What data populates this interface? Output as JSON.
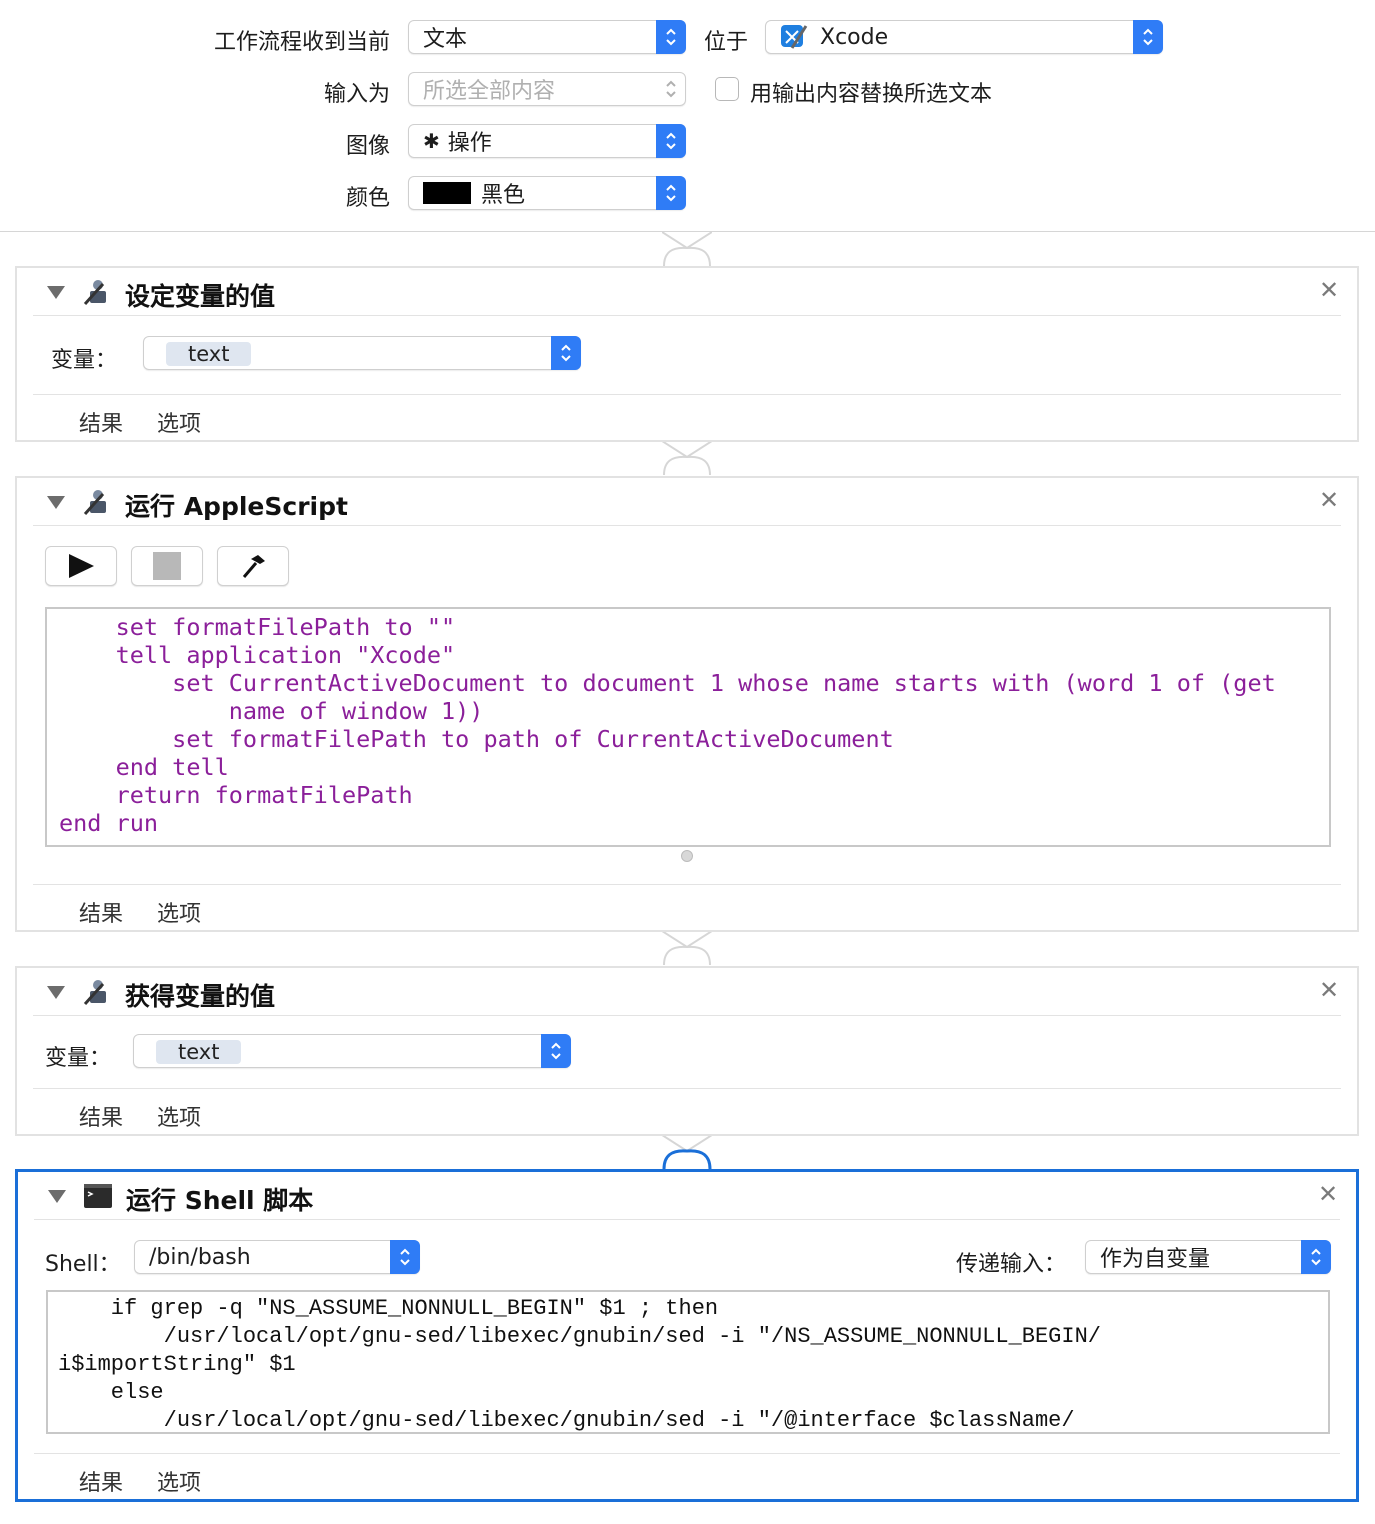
{
  "header": {
    "receives_label": "工作流程收到当前",
    "receives_value": "文本",
    "in_label": "位于",
    "in_value": "Xcode",
    "input_label": "输入为",
    "input_value": "所选全部内容",
    "replace_label": "用输出内容替换所选文本",
    "image_label": "图像",
    "image_value": "操作",
    "color_label": "颜色",
    "color_value": "黑色",
    "color_swatch": "#000000"
  },
  "actions": [
    {
      "title": "设定变量的值",
      "icon": "automator-robot-icon",
      "variable_label": "变量：",
      "variable_value": "text",
      "results_label": "结果",
      "options_label": "选项"
    },
    {
      "title": "运行 AppleScript",
      "icon": "automator-robot-icon",
      "toolbar": [
        "run-icon",
        "stop-icon",
        "compile-hammer-icon"
      ],
      "code": [
        "    set formatFilePath to \"\"",
        "    tell application \"Xcode\"",
        "        set CurrentActiveDocument to document 1 whose name starts with (word 1 of (get",
        "            name of window 1))",
        "        set formatFilePath to path of CurrentActiveDocument",
        "    end tell",
        "    return formatFilePath",
        "end run"
      ],
      "results_label": "结果",
      "options_label": "选项"
    },
    {
      "title": "获得变量的值",
      "icon": "automator-robot-icon",
      "variable_label": "变量：",
      "variable_value": "text",
      "results_label": "结果",
      "options_label": "选项"
    },
    {
      "title": "运行 Shell 脚本",
      "icon": "terminal-icon",
      "shell_label": "Shell：",
      "shell_value": "/bin/bash",
      "pass_label": "传递输入：",
      "pass_value": "作为自变量",
      "code": [
        "    if grep -q \"NS_ASSUME_NONNULL_BEGIN\" $1 ; then",
        "        /usr/local/opt/gnu-sed/libexec/gnubin/sed -i \"/NS_ASSUME_NONNULL_BEGIN/",
        "i$importString\" $1",
        "    else",
        "        /usr/local/opt/gnu-sed/libexec/gnubin/sed -i \"/@interface $className/"
      ],
      "results_label": "结果",
      "options_label": "选项"
    }
  ],
  "colors": {
    "accent": "#2f7cf6",
    "selected_border": "#1a6fd8",
    "applescript_text": "#8b1f9a"
  }
}
